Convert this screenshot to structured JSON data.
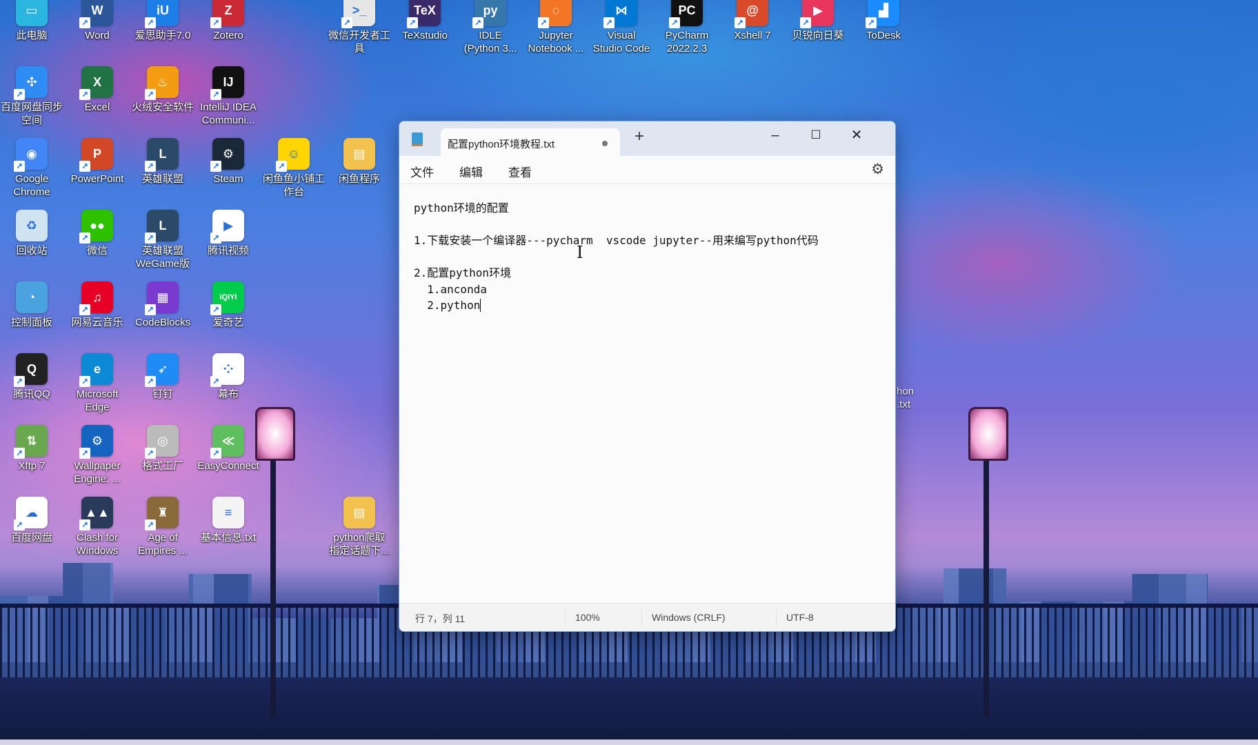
{
  "desktop": {
    "icons": [
      {
        "label": "此电脑",
        "col": 0,
        "row": 0,
        "color": "#2bb6e0",
        "glyph": "▭",
        "shortcut": false
      },
      {
        "label": "Word",
        "col": 1,
        "row": 0,
        "color": "#2b579a",
        "glyph": "W",
        "shortcut": true
      },
      {
        "label": "爱思助手7.0",
        "col": 2,
        "row": 0,
        "color": "#1e7ee8",
        "glyph": "iU",
        "shortcut": true
      },
      {
        "label": "Zotero",
        "col": 3,
        "row": 0,
        "color": "#cc2936",
        "glyph": "Z",
        "shortcut": true
      },
      {
        "label": "微信开发者工\n具",
        "col": 5,
        "row": 0,
        "color": "#e6e6e6",
        "glyph": ">_",
        "shortcut": true
      },
      {
        "label": "TeXstudio",
        "col": 6,
        "row": 0,
        "color": "#3a2a6a",
        "glyph": "TeX",
        "shortcut": true
      },
      {
        "label": "IDLE\n(Python 3...",
        "col": 7,
        "row": 0,
        "color": "#3776ab",
        "glyph": "py",
        "shortcut": true
      },
      {
        "label": "Jupyter\nNotebook ...",
        "col": 8,
        "row": 0,
        "color": "#f37626",
        "glyph": "◌",
        "shortcut": true
      },
      {
        "label": "Visual\nStudio Code",
        "col": 9,
        "row": 0,
        "color": "#0078d4",
        "glyph": "⋈",
        "shortcut": true
      },
      {
        "label": "PyCharm\n2022.2.3",
        "col": 10,
        "row": 0,
        "color": "#111111",
        "glyph": "PC",
        "shortcut": true
      },
      {
        "label": "Xshell 7",
        "col": 11,
        "row": 0,
        "color": "#d94a2a",
        "glyph": "@",
        "shortcut": true
      },
      {
        "label": "贝锐向日葵",
        "col": 12,
        "row": 0,
        "color": "#e8365d",
        "glyph": "▶",
        "shortcut": true
      },
      {
        "label": "ToDesk",
        "col": 13,
        "row": 0,
        "color": "#1a8cff",
        "glyph": "▟",
        "shortcut": true
      },
      {
        "label": "百度网盘同步\n空间",
        "col": 0,
        "row": 1,
        "color": "#2f8cf2",
        "glyph": "✣",
        "shortcut": true
      },
      {
        "label": "Excel",
        "col": 1,
        "row": 1,
        "color": "#217346",
        "glyph": "X",
        "shortcut": true
      },
      {
        "label": "火绒安全软件",
        "col": 2,
        "row": 1,
        "color": "#f39c12",
        "glyph": "♨",
        "shortcut": true
      },
      {
        "label": "IntelliJ IDEA\nCommuni...",
        "col": 3,
        "row": 1,
        "color": "#111111",
        "glyph": "IJ",
        "shortcut": true
      },
      {
        "label": "Google\nChrome",
        "col": 0,
        "row": 2,
        "color": "#4285f4",
        "glyph": "◉",
        "shortcut": true
      },
      {
        "label": "PowerPoint",
        "col": 1,
        "row": 2,
        "color": "#d24726",
        "glyph": "P",
        "shortcut": true
      },
      {
        "label": "英雄联盟",
        "col": 2,
        "row": 2,
        "color": "#2b4a6a",
        "glyph": "L",
        "shortcut": true
      },
      {
        "label": "Steam",
        "col": 3,
        "row": 2,
        "color": "#1b2838",
        "glyph": "⚙",
        "shortcut": true
      },
      {
        "label": "闲鱼鱼小铺工\n作台",
        "col": 4,
        "row": 2,
        "color": "#ffd400",
        "glyph": "☺",
        "shortcut": true
      },
      {
        "label": "闲鱼程序",
        "col": 5,
        "row": 2,
        "color": "#f2c14e",
        "glyph": "▤",
        "shortcut": false
      },
      {
        "label": "回收站",
        "col": 0,
        "row": 3,
        "color": "#cfe3f0",
        "glyph": "♻",
        "shortcut": false
      },
      {
        "label": "微信",
        "col": 1,
        "row": 3,
        "color": "#2dc100",
        "glyph": "●●",
        "shortcut": true
      },
      {
        "label": "英雄联盟\nWeGame版",
        "col": 2,
        "row": 3,
        "color": "#2b4a6a",
        "glyph": "L",
        "shortcut": true
      },
      {
        "label": "腾讯视频",
        "col": 3,
        "row": 3,
        "color": "#ffffff",
        "glyph": "▶",
        "shortcut": true
      },
      {
        "label": "控制面板",
        "col": 0,
        "row": 4,
        "color": "#4aa3df",
        "glyph": "◔",
        "shortcut": false
      },
      {
        "label": "网易云音乐",
        "col": 1,
        "row": 4,
        "color": "#e60026",
        "glyph": "♫",
        "shortcut": true
      },
      {
        "label": "CodeBlocks",
        "col": 2,
        "row": 4,
        "color": "#7a3ad0",
        "glyph": "▦",
        "shortcut": true
      },
      {
        "label": "爱奇艺",
        "col": 3,
        "row": 4,
        "color": "#00cc4c",
        "glyph": "iQIYI",
        "shortcut": true
      },
      {
        "label": "腾讯QQ",
        "col": 0,
        "row": 5,
        "color": "#222222",
        "glyph": "Q",
        "shortcut": true
      },
      {
        "label": "Microsoft\nEdge",
        "col": 1,
        "row": 5,
        "color": "#0c8ad6",
        "glyph": "e",
        "shortcut": true
      },
      {
        "label": "钉钉",
        "col": 2,
        "row": 5,
        "color": "#1f8cf5",
        "glyph": "➶",
        "shortcut": true
      },
      {
        "label": "幕布",
        "col": 3,
        "row": 5,
        "color": "#ffffff",
        "glyph": "⁘",
        "shortcut": true
      },
      {
        "label": "Xftp 7",
        "col": 0,
        "row": 6,
        "color": "#6aa84f",
        "glyph": "⇅",
        "shortcut": true
      },
      {
        "label": "Wallpaper\nEngine: ...",
        "col": 1,
        "row": 6,
        "color": "#1565c0",
        "glyph": "⚙",
        "shortcut": true
      },
      {
        "label": "格式工厂",
        "col": 2,
        "row": 6,
        "color": "#bbbbbb",
        "glyph": "◎",
        "shortcut": true
      },
      {
        "label": "EasyConnect",
        "col": 3,
        "row": 6,
        "color": "#5fbf5f",
        "glyph": "≪",
        "shortcut": true
      },
      {
        "label": "百度网盘",
        "col": 0,
        "row": 7,
        "color": "#ffffff",
        "glyph": "☁",
        "shortcut": true
      },
      {
        "label": "Clash for\nWindows",
        "col": 1,
        "row": 7,
        "color": "#2a3a5a",
        "glyph": "▲▲",
        "shortcut": true
      },
      {
        "label": "Age of\nEmpires ...",
        "col": 2,
        "row": 7,
        "color": "#8a6a3a",
        "glyph": "♜",
        "shortcut": true
      },
      {
        "label": "基本信息.txt",
        "col": 3,
        "row": 7,
        "color": "#f4f4f4",
        "glyph": "≡",
        "shortcut": false
      },
      {
        "label": "python爬取\n指定话题下...",
        "col": 5,
        "row": 7,
        "color": "#f2c14e",
        "glyph": "▤",
        "shortcut": false
      }
    ],
    "hidden_icon_fragment": "hon\n.txt"
  },
  "notepad": {
    "tab_title": "配置python环境教程.txt",
    "new_tab": "+",
    "window_controls": {
      "minimize": "–",
      "maximize": "☐",
      "close": "✕"
    },
    "menu": [
      "文件",
      "编辑",
      "查看"
    ],
    "settings_icon": "gear-icon",
    "content_lines": [
      "python环境的配置",
      "",
      "1.下载安装一个编译器---pycharm  vscode jupyter--用来编写python代码",
      "",
      "2.配置python环境",
      "  1.anconda",
      "  2.python"
    ],
    "status": {
      "position": "行 7，列 11",
      "zoom": "100%",
      "line_ending": "Windows (CRLF)",
      "encoding": "UTF-8"
    }
  }
}
